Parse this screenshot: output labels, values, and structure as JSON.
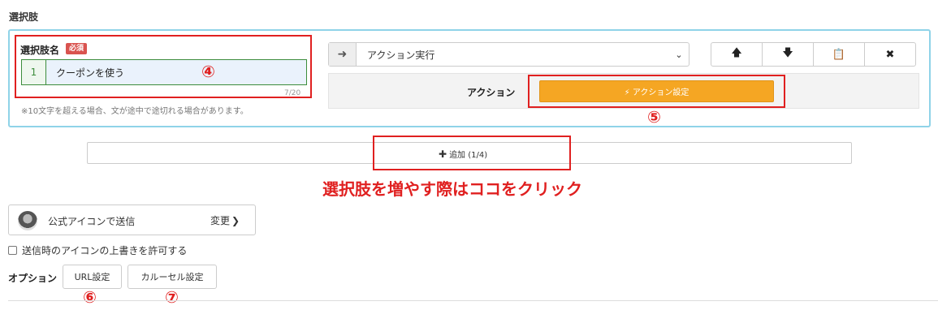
{
  "section": {
    "title": "選択肢"
  },
  "choice": {
    "name_label": "選択肢名",
    "required_badge": "必須",
    "index": "1",
    "value": "クーポンを使う",
    "counter": "7/20",
    "note": "※10文字を超える場合、文が途中で途切れる場合があります。",
    "marker": "④"
  },
  "action": {
    "prefix_icon": "arrow-right-icon",
    "selected": "アクション実行",
    "label": "アクション",
    "button_label": "⚡ アクション設定",
    "marker": "⑤"
  },
  "controls": {
    "up": "🡅",
    "down": "🡇",
    "copy": "📋",
    "delete": "✖"
  },
  "add": {
    "plus": "✚",
    "label": "追加 (1/4)"
  },
  "callout": "選択肢を増やす際はココをクリック",
  "sender": {
    "label": "公式アイコンで送信",
    "change": "変更",
    "change_chevron": "❯"
  },
  "override": {
    "label": "送信時のアイコンの上書きを許可する"
  },
  "options": {
    "label": "オプション",
    "url_button": "URL設定",
    "carousel_button": "カルーセル設定",
    "url_marker": "⑥",
    "carousel_marker": "⑦"
  },
  "colors": {
    "highlight": "#e02020",
    "action_button": "#f5a623",
    "panel_border": "#8fd3e8",
    "input_border": "#3c8d3c",
    "input_bg": "#eaf2fc"
  }
}
